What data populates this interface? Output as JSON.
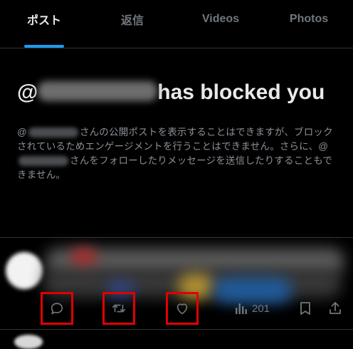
{
  "tabs": [
    {
      "label": "ポスト",
      "active": true
    },
    {
      "label": "返信",
      "active": false
    },
    {
      "label": "Videos",
      "active": false
    },
    {
      "label": "Photos",
      "active": false
    }
  ],
  "blocked": {
    "title_prefix": "@",
    "title_suffix": "has blocked you",
    "body_line_1_prefix": "@",
    "body_line_1_suffix": "さんの公開ポストを表示することはできますが、ブロックされているためエンゲージメントを行うことはできません。さらに、@",
    "body_line_2_suffix": "さんをフォローしたりメッセージを送信したりすることもできません。"
  },
  "post": {
    "views_count": "201"
  },
  "icons": {
    "reply": "reply-icon",
    "retweet": "repost-icon",
    "like": "heart-icon",
    "views": "views-bar-icon",
    "bookmark": "bookmark-icon",
    "share": "share-icon"
  },
  "colors": {
    "background": "#000000",
    "accent": "#1d9bf0",
    "highlight_box": "#e10000",
    "muted_text": "#71767b"
  }
}
